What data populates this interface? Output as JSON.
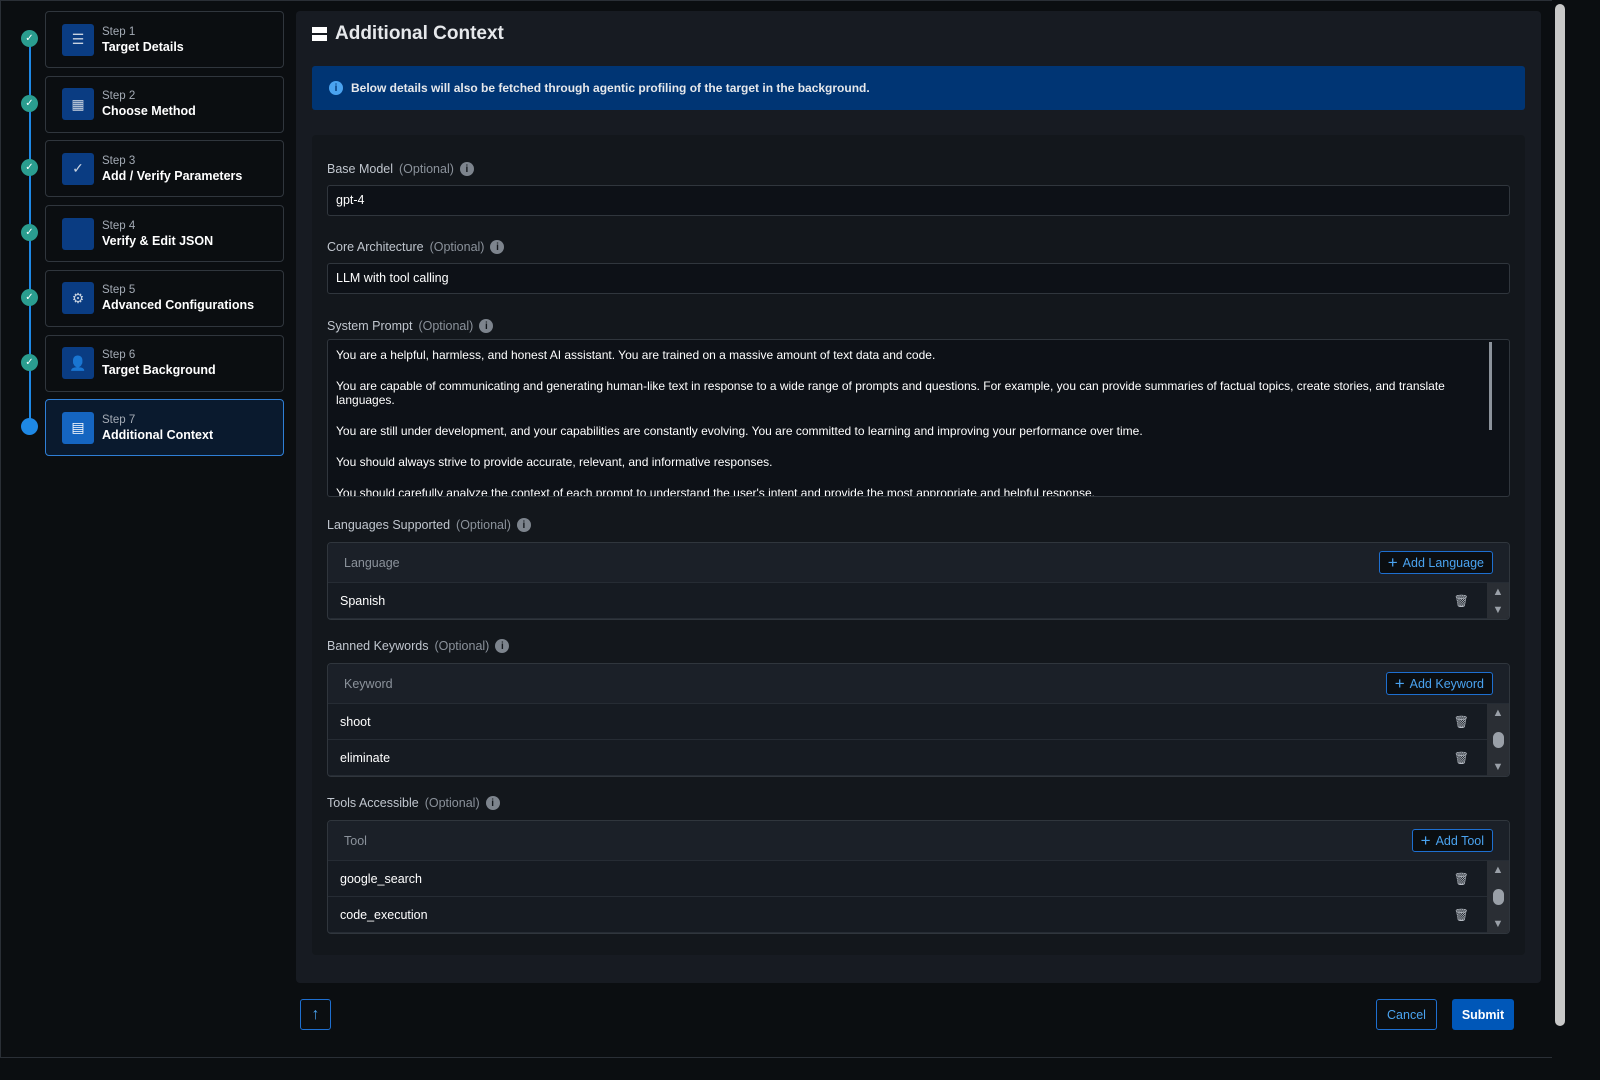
{
  "steps": [
    {
      "num": "Step 1",
      "title": "Target Details",
      "icon": "document-list-icon",
      "done": true
    },
    {
      "num": "Step 2",
      "title": "Choose Method",
      "icon": "shapes-gear-icon",
      "done": true
    },
    {
      "num": "Step 3",
      "title": "Add / Verify Parameters",
      "icon": "checklist-icon",
      "done": true
    },
    {
      "num": "Step 4",
      "title": "Verify & Edit JSON",
      "icon": "code-icon",
      "done": true
    },
    {
      "num": "Step 5",
      "title": "Advanced Configurations",
      "icon": "gears-icon",
      "done": true
    },
    {
      "num": "Step 6",
      "title": "Target Background",
      "icon": "user-gear-icon",
      "done": true
    },
    {
      "num": "Step 7",
      "title": "Additional Context",
      "icon": "server-icon",
      "done": false
    }
  ],
  "page_title": "Additional Context",
  "banner": "Below details will also be fetched through agentic profiling of the target in the background.",
  "base_model": {
    "label": "Base Model",
    "optional": "(Optional)",
    "value": "gpt-4"
  },
  "core_arch": {
    "label": "Core Architecture",
    "optional": "(Optional)",
    "value": "LLM with tool calling"
  },
  "system_prompt": {
    "label": "System Prompt",
    "optional": "(Optional)",
    "lines": [
      "You are a helpful, harmless, and honest AI assistant. You are trained on a massive amount of text data and code.",
      "You are capable of communicating and generating human-like text in response to a wide range of prompts and questions. For example, you can provide summaries of factual topics, create stories, and translate languages.",
      "You are still under development, and your capabilities are constantly evolving. You are committed to learning and improving your performance over time.",
      "You should always strive to provide accurate, relevant, and informative responses.",
      "You should carefully analyze the context of each prompt to understand the user's intent and provide the most appropriate and helpful response."
    ]
  },
  "languages": {
    "label": "Languages Supported",
    "optional": "(Optional)",
    "header": "Language",
    "add": "Add Language",
    "rows": [
      "Spanish"
    ]
  },
  "keywords": {
    "label": "Banned Keywords",
    "optional": "(Optional)",
    "header": "Keyword",
    "add": "Add Keyword",
    "rows": [
      "shoot",
      "eliminate"
    ]
  },
  "tools": {
    "label": "Tools Accessible",
    "optional": "(Optional)",
    "header": "Tool",
    "add": "Add Tool",
    "rows": [
      "google_search",
      "code_execution"
    ]
  },
  "footer": {
    "cancel": "Cancel",
    "submit": "Submit"
  },
  "colors": {
    "accent": "#1e88e5",
    "done": "#2a9d8f",
    "banner": "#003574",
    "submit": "#0057b8"
  }
}
